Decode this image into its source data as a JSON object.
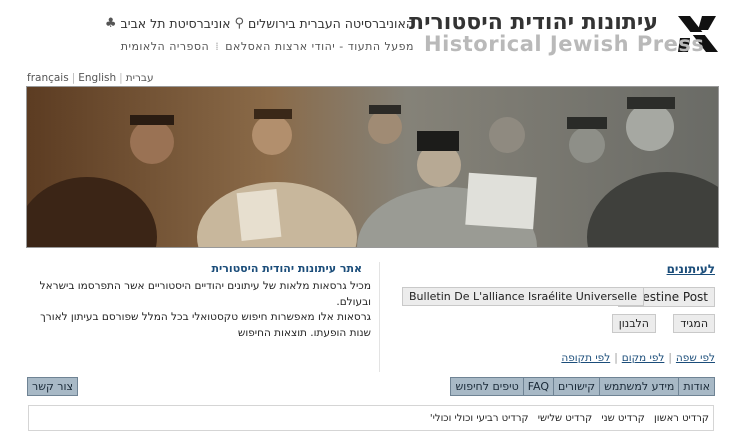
{
  "header": {
    "title_he": "עיתונות יהודית היסטורית",
    "title_en": "Historical Jewish Press",
    "institutions_line1": [
      "האוניברסיטה העברית בירושלים",
      "אוניברסיטת תל אביב"
    ],
    "institutions_line2": [
      "מפעל התעוד - יהודי ארצות האסלאם",
      "הספריה הלאומית"
    ]
  },
  "languages": [
    "français",
    "English",
    "עברית"
  ],
  "about": {
    "title": "אתר עיתונות יהודית היסטורית",
    "paragraph1": "מכיל גרסאות מלאות של עיתונים יהודיים היסטוריים אשר התפרסמו בישראל ובעולם.",
    "paragraph2": "גרסאות אלו מאפשרות חיפוש טקסטואלי בכל המלל שפורסם בעיתון לאורך שנות הופעתו. תוצאות החיפוש"
  },
  "newspapers": {
    "heading": "לעיתונים",
    "items": [
      "Palestine Post",
      "Bulletin De L'alliance Israélite Universelle",
      "המגיד",
      "הלבנון"
    ],
    "browse_by": [
      "לפי שפה",
      "לפי מקום",
      "לפי תקופה"
    ]
  },
  "nav": {
    "items": [
      "אודות",
      "מידע למשתמש",
      "קישורים",
      "FAQ",
      "טיפים לחיפוש"
    ],
    "contact": "צור קשר"
  },
  "credits": [
    "קרדיט ראשון",
    "קרדיט שני",
    "קרדיט שלישי",
    "קרדיט רביעי וכולי וכולי'"
  ],
  "colors": {
    "link_blue": "#1b4d7a",
    "nav_bg": "#a8b9c6",
    "button_bg": "#ececec"
  }
}
